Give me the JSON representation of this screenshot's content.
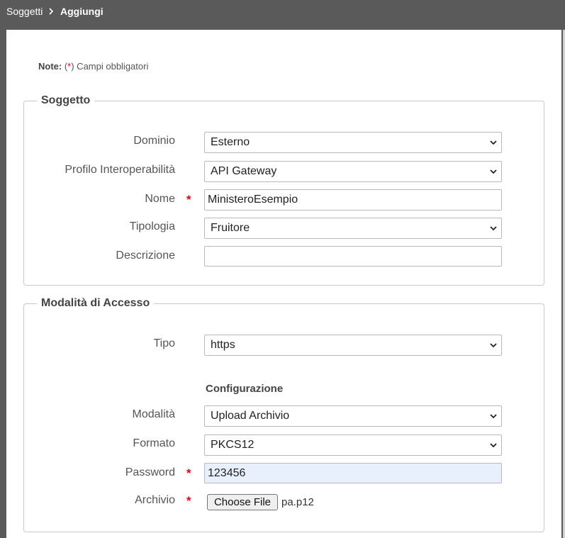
{
  "breadcrumb": {
    "parent": "Soggetti",
    "current": "Aggiungi"
  },
  "note": {
    "label": "Note:",
    "open": " (",
    "star": "*",
    "text": ") Campi obbligatori"
  },
  "soggetto": {
    "legend": "Soggetto",
    "dominio": {
      "label": "Dominio",
      "value": "Esterno"
    },
    "profilo": {
      "label": "Profilo Interoperabilità",
      "value": "API Gateway"
    },
    "nome": {
      "label": "Nome",
      "required": "*",
      "value": "MinisteroEsempio"
    },
    "tipologia": {
      "label": "Tipologia",
      "value": "Fruitore"
    },
    "descrizione": {
      "label": "Descrizione",
      "value": ""
    }
  },
  "accesso": {
    "legend": "Modalità di Accesso",
    "tipo": {
      "label": "Tipo",
      "value": "https"
    },
    "configurazione": "Configurazione",
    "modalita": {
      "label": "Modalità",
      "value": "Upload Archivio"
    },
    "formato": {
      "label": "Formato",
      "value": "PKCS12"
    },
    "password": {
      "label": "Password",
      "required": "*",
      "value": "123456"
    },
    "archivio": {
      "label": "Archivio",
      "required": "*",
      "button": "Choose File",
      "file": "pa.p12"
    }
  },
  "icons": {
    "breadcrumb_sep": "chevron-right-icon",
    "select": "chevron-down-icon"
  },
  "colors": {
    "required": "#e0001a",
    "header": "#5a5a5a",
    "autofill": "#e8f0fe"
  }
}
